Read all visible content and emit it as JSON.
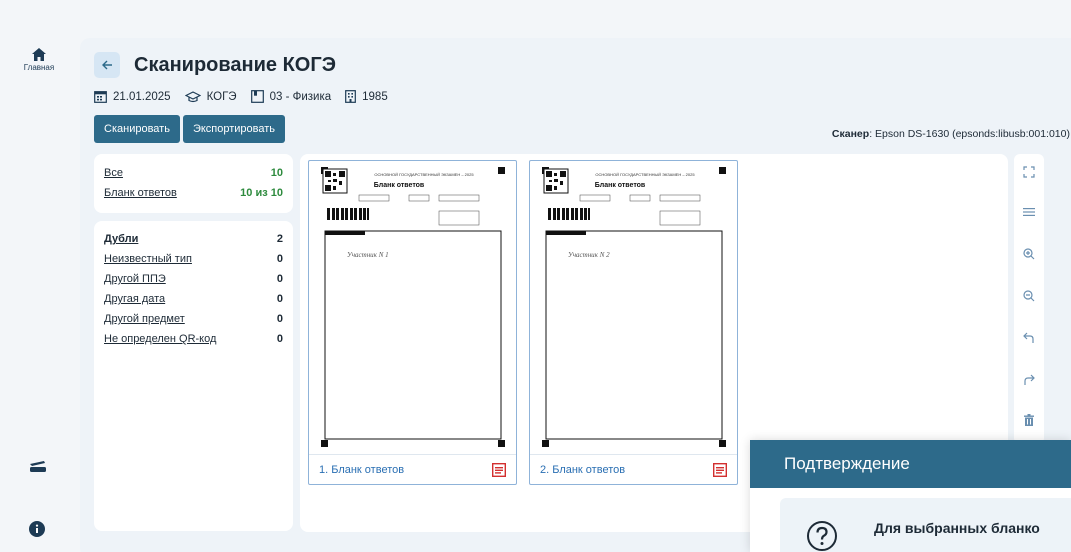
{
  "nav": {
    "home_label": "Главная"
  },
  "header": {
    "title": "Сканирование КОГЭ"
  },
  "meta": {
    "date": "21.01.2025",
    "exam_type": "КОГЭ",
    "subject": "03 - Физика",
    "building": "1985"
  },
  "toolbar": {
    "scan_label": "Сканировать",
    "export_label": "Экспортировать"
  },
  "scanner": {
    "label": "Сканер",
    "value": ": Epson DS-1630 (epsonds:libusb:001:010)"
  },
  "filters_main": [
    {
      "label": "Все",
      "count": "10"
    },
    {
      "label": "Бланк ответов",
      "count": "10 из 10"
    }
  ],
  "filters_problems": [
    {
      "label": "Дубли",
      "count": "2"
    },
    {
      "label": "Неизвестный тип",
      "count": "0"
    },
    {
      "label": "Другой ППЭ",
      "count": "0"
    },
    {
      "label": "Другая дата",
      "count": "0"
    },
    {
      "label": "Другой предмет",
      "count": "0"
    },
    {
      "label": "Не определен QR-код",
      "count": "0"
    }
  ],
  "thumbnails": [
    {
      "caption": "1. Бланк ответов",
      "form_header": "ОСНОВНОЙ ГОСУДАРСТВЕННЫЙ ЭКЗАМЕН – 2025",
      "form_title": "Бланк ответов",
      "handwriting": "Участник N 1"
    },
    {
      "caption": "2. Бланк ответов",
      "form_header": "ОСНОВНОЙ ГОСУДАРСТВЕННЫЙ ЭКЗАМЕН – 2025",
      "form_title": "Бланк ответов",
      "handwriting": "Участник N 2"
    }
  ],
  "dialog": {
    "title": "Подтверждение",
    "text": "Для выбранных бланко"
  },
  "colors": {
    "primary": "#2d6a8a",
    "accent_green": "#2e8b3e",
    "link_blue": "#2a6fb3",
    "delete_red": "#d32f2f"
  }
}
